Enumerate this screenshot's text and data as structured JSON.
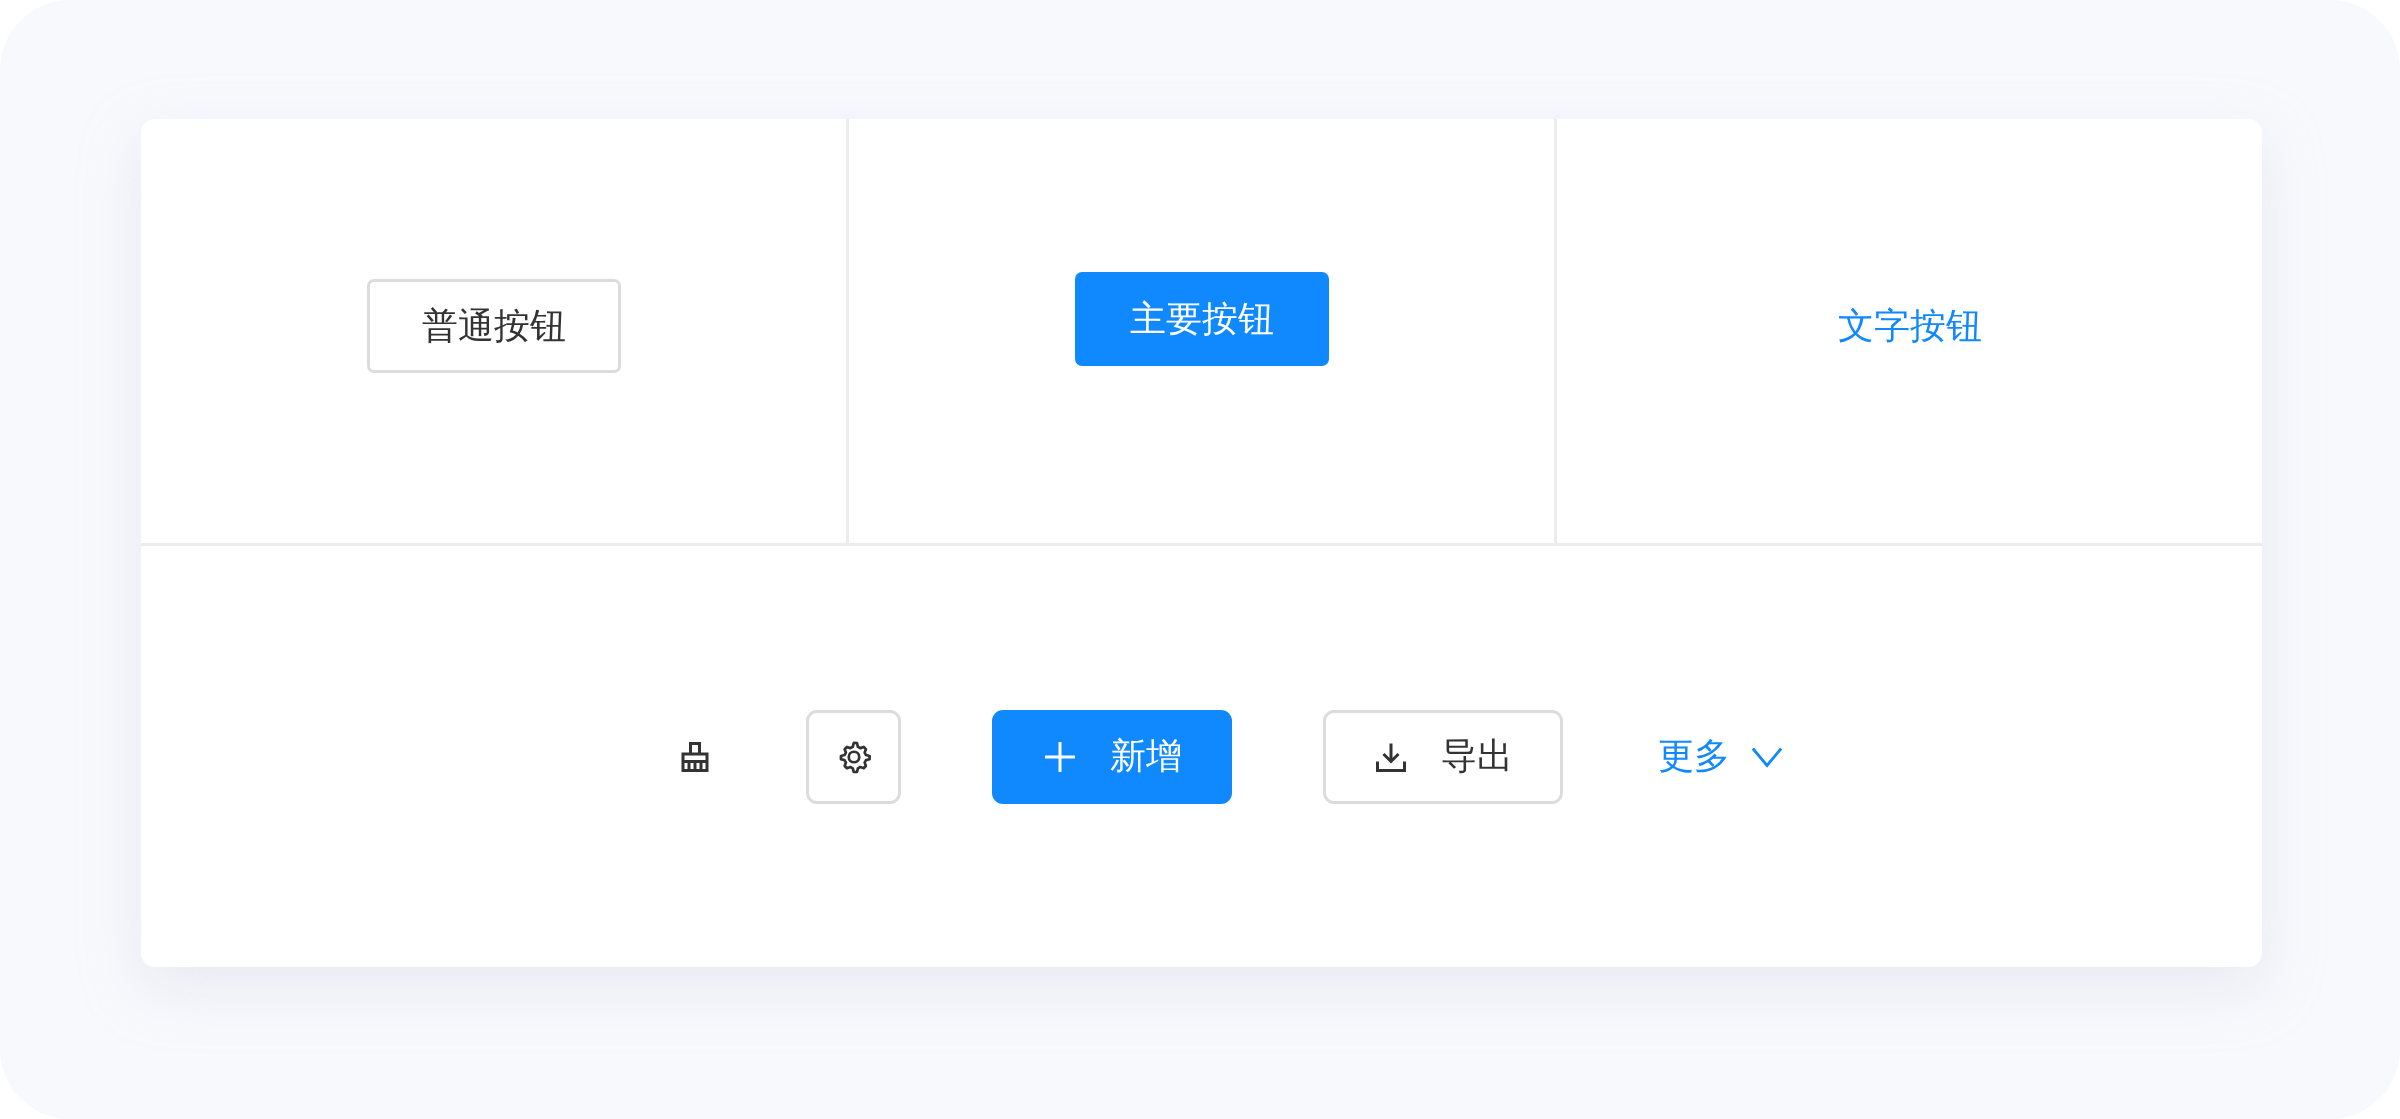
{
  "top_buttons": [
    {
      "kind": "default",
      "label": "普通按钮"
    },
    {
      "kind": "primary",
      "label": "主要按钮"
    },
    {
      "kind": "text",
      "label": "文字按钮"
    }
  ],
  "toolbar": [
    {
      "kind": "plain-icon"
    },
    {
      "kind": "icon-button"
    },
    {
      "kind": "primary",
      "label": "新增"
    },
    {
      "kind": "default",
      "label": "导出"
    },
    {
      "kind": "text",
      "label": "更多"
    }
  ]
}
